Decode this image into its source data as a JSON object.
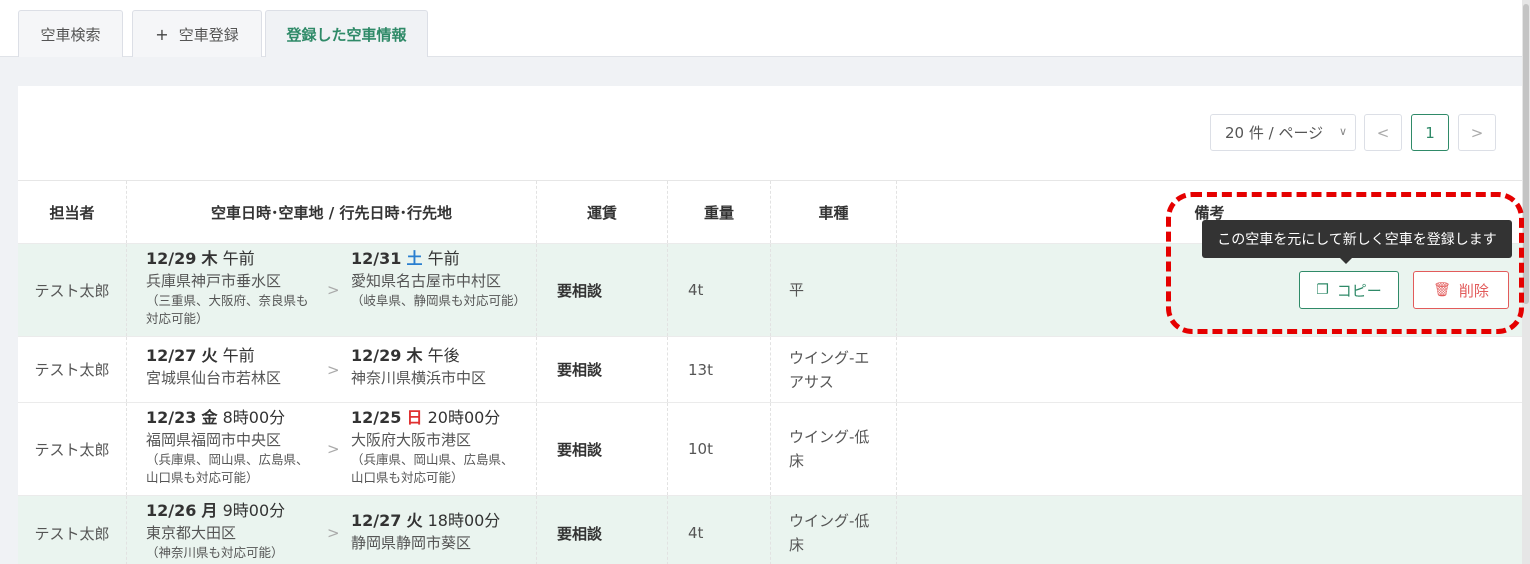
{
  "tabs": [
    {
      "label": "空車検索"
    },
    {
      "icon": "+",
      "label": "空車登録"
    },
    {
      "label": "登録した空車情報"
    }
  ],
  "pager": {
    "page_size": "20 件 / ページ",
    "prev": "<",
    "current": "1",
    "next": ">"
  },
  "table": {
    "headers": {
      "owner": "担当者",
      "route": "空車日時･空車地 / 行先日時･行先地",
      "fare": "運賃",
      "weight": "重量",
      "vehicle": "車種",
      "remarks": "備考"
    },
    "rows": [
      {
        "owner": "テスト太郎",
        "from": {
          "date": "12/29",
          "dow": "木",
          "time": "午前",
          "place": "兵庫県神戸市垂水区",
          "note": "（三重県、大阪府、奈良県も対応可能）"
        },
        "to": {
          "date": "12/31",
          "dow": "土",
          "time": "午前",
          "place": "愛知県名古屋市中村区",
          "note": "（岐阜県、静岡県も対応可能）"
        },
        "fare": "要相談",
        "weight": "4t",
        "vehicle": "平"
      },
      {
        "owner": "テスト太郎",
        "from": {
          "date": "12/27",
          "dow": "火",
          "time": "午前",
          "place": "宮城県仙台市若林区",
          "note": ""
        },
        "to": {
          "date": "12/29",
          "dow": "木",
          "time": "午後",
          "place": "神奈川県横浜市中区",
          "note": ""
        },
        "fare": "要相談",
        "weight": "13t",
        "vehicle": "ウイング-エアサス"
      },
      {
        "owner": "テスト太郎",
        "from": {
          "date": "12/23",
          "dow": "金",
          "time": "8時00分",
          "place": "福岡県福岡市中央区",
          "note": "（兵庫県、岡山県、広島県、山口県も対応可能）"
        },
        "to": {
          "date": "12/25",
          "dow": "日",
          "time": "20時00分",
          "place": "大阪府大阪市港区",
          "note": "（兵庫県、岡山県、広島県、山口県も対応可能）"
        },
        "fare": "要相談",
        "weight": "10t",
        "vehicle": "ウイング-低床"
      },
      {
        "owner": "テスト太郎",
        "from": {
          "date": "12/26",
          "dow": "月",
          "time": "9時00分",
          "place": "東京都大田区",
          "note": "（神奈川県も対応可能）"
        },
        "to": {
          "date": "12/27",
          "dow": "火",
          "time": "18時00分",
          "place": "静岡県静岡市葵区",
          "note": ""
        },
        "fare": "要相談",
        "weight": "4t",
        "vehicle": "ウイング-低床"
      }
    ],
    "arrow": ">"
  },
  "actions": {
    "tooltip": "この空車を元にして新しく空車を登録します",
    "copy_label": "コピー",
    "delete_label": "削除"
  },
  "colors": {
    "accent": "#2f8a68",
    "danger": "#e25b5b",
    "saturday": "#2a7fd0",
    "sunday": "#e03131",
    "highlight_row": "#eaf4ef",
    "annotation": "#e50000"
  }
}
